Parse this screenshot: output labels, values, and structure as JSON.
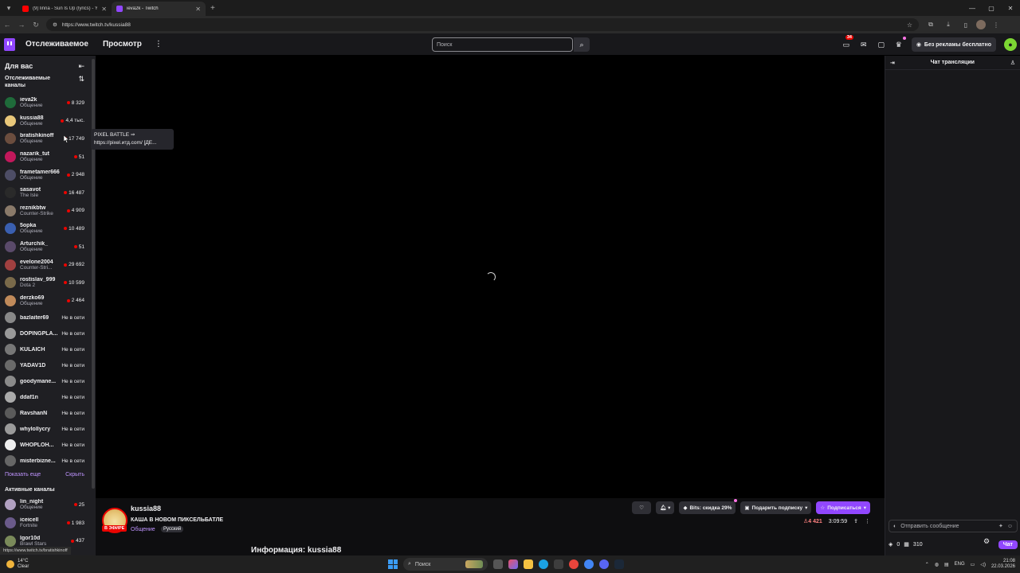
{
  "browser": {
    "tabs": [
      {
        "title": "(9) linna - Sun Is Up (lyrics) - Yo",
        "favicon_color": "#ff0000",
        "active": false
      },
      {
        "title": "ieva2k - Twitch",
        "favicon_color": "#9147ff",
        "active": true
      }
    ],
    "new_tab": "+",
    "url": "https://www.twitch.tv/kussia88"
  },
  "topnav": {
    "following": "Отслеживаемое",
    "browse": "Просмотр",
    "search_placeholder": "Поиск",
    "notifications_count": "34",
    "no_ads": "Без рекламы бесплатно"
  },
  "sidebar": {
    "for_you": "Для вас",
    "followed_title": "Отслеживаемые каналы",
    "channels": [
      {
        "name": "ieva2k",
        "category": "Общение",
        "viewers": "8 329",
        "live": true,
        "color": "#1f6b3a"
      },
      {
        "name": "kussia88",
        "category": "Общение",
        "viewers": "4,4 тыс.",
        "live": true,
        "color": "#e8c77a"
      },
      {
        "name": "bratishkinoff",
        "category": "Общение",
        "viewers": "17 749",
        "live": true,
        "color": "#6b4d3e"
      },
      {
        "name": "nazarik_tut",
        "category": "Общение",
        "viewers": "51",
        "live": true,
        "color": "#c2185b"
      },
      {
        "name": "frametamer666",
        "category": "Общение",
        "viewers": "2 948",
        "live": true,
        "color": "#4d4d66"
      },
      {
        "name": "sasavot",
        "category": "The Isle",
        "viewers": "16 487",
        "live": true,
        "color": "#2a2a2a"
      },
      {
        "name": "reznikbtw",
        "category": "Counter-Strike",
        "viewers": "4 909",
        "live": true,
        "color": "#8a7a6a"
      },
      {
        "name": "5opka",
        "category": "Общение",
        "viewers": "10 489",
        "live": true,
        "color": "#3a5fb0"
      },
      {
        "name": "Arturchik_",
        "category": "Общение",
        "viewers": "51",
        "live": true,
        "color": "#5a4a6a"
      },
      {
        "name": "evelone2004",
        "category": "Counter-Stri...",
        "viewers": "29 692",
        "live": true,
        "color": "#a04040"
      },
      {
        "name": "rostislav_999",
        "category": "Dota 2",
        "viewers": "10 599",
        "live": true,
        "color": "#7a6a4a"
      },
      {
        "name": "derzko69",
        "category": "Общение",
        "viewers": "2 464",
        "live": true,
        "color": "#c08a5a"
      },
      {
        "name": "bazlaiter69",
        "category": "",
        "viewers": "Не в сети",
        "live": false,
        "color": "#888888"
      },
      {
        "name": "DOPINGPLA...",
        "category": "",
        "viewers": "Не в сети",
        "live": false,
        "color": "#999999"
      },
      {
        "name": "KULAICH",
        "category": "",
        "viewers": "Не в сети",
        "live": false,
        "color": "#777777"
      },
      {
        "name": "YADAV1D",
        "category": "",
        "viewers": "Не в сети",
        "live": false,
        "color": "#6a6a6a"
      },
      {
        "name": "goodymane...",
        "category": "",
        "viewers": "Не в сети",
        "live": false,
        "color": "#8a8a8a"
      },
      {
        "name": "ddaf1n",
        "category": "",
        "viewers": "Не в сети",
        "live": false,
        "color": "#aaaaaa"
      },
      {
        "name": "RavshanN",
        "category": "",
        "viewers": "Не в сети",
        "live": false,
        "color": "#5a5a5a"
      },
      {
        "name": "whylollycry",
        "category": "",
        "viewers": "Не в сети",
        "live": false,
        "color": "#9a9a9a"
      },
      {
        "name": "WHOPLOH...",
        "category": "",
        "viewers": "Не в сети",
        "live": false,
        "color": "#eeeeee"
      },
      {
        "name": "misterbizne...",
        "category": "",
        "viewers": "Не в сети",
        "live": false,
        "color": "#666666"
      }
    ],
    "show_more": "Показать еще",
    "hide": "Скрыть",
    "active_title": "Активные каналы",
    "active_channels": [
      {
        "name": "lin_night",
        "category": "Общение",
        "viewers": "25",
        "color": "#b0a0c0"
      },
      {
        "name": "iceicell",
        "category": "Fortnite",
        "viewers": "1 983",
        "color": "#6a5a8a"
      },
      {
        "name": "Igor10d",
        "category": "Brawl Stars",
        "viewers": "437",
        "color": "#7a8a5a"
      }
    ]
  },
  "tooltip": {
    "line1": "PIXEL BATTLE ⇒",
    "line2": "https://pixel.итд.com/ [ДЕ..."
  },
  "stream": {
    "streamer": "kussia88",
    "live_label": "В ЭФИРЕ",
    "title": "КАША В НОВОМ ПИКСЕЛЬБАТЛЕ",
    "category": "Общение",
    "language": "Русский",
    "bits_label": "Bits: скидка 29%",
    "gift_label": "Подарить подписку",
    "subscribe_label": "Подписаться",
    "viewers": "4 421",
    "uptime": "3:09:59",
    "about": "Информация: kussia88"
  },
  "chat": {
    "title": "Чат трансляции",
    "placeholder": "Отправить сообщение",
    "points": "0",
    "bits": "310",
    "send": "Чат"
  },
  "status_url": "https://www.twitch.tv/bratishkinoff",
  "taskbar": {
    "temperature": "14°C",
    "weather": "Clear",
    "search": "Поиск",
    "lang": "ENG",
    "time": "21:08",
    "date": "22.03.2026"
  }
}
